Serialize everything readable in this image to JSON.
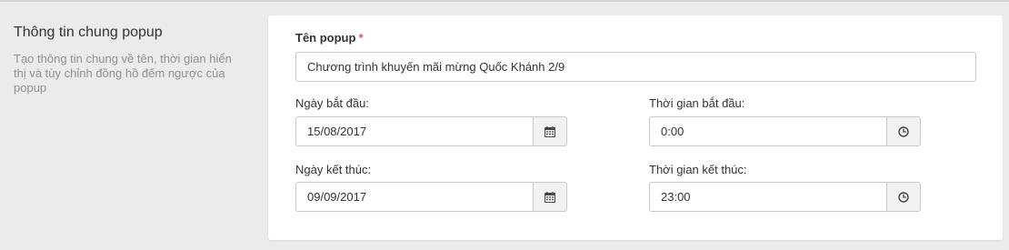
{
  "section": {
    "title": "Thông tin chung popup",
    "description": "Tạo thông tin chung về tên, thời gian hiển thị và tùy chỉnh đồng hồ đếm ngược của popup"
  },
  "form": {
    "name": {
      "label": "Tên popup",
      "required_mark": "*",
      "value": "Chương trình khuyến mãi mừng Quốc Khánh 2/9"
    },
    "start_date": {
      "label": "Ngày bắt đầu:",
      "value": "15/08/2017",
      "icon": "calendar-icon"
    },
    "start_time": {
      "label": "Thời gian bắt đầu:",
      "value": "0:00",
      "icon": "clock-icon"
    },
    "end_date": {
      "label": "Ngày kết thúc:",
      "value": "09/09/2017",
      "icon": "calendar-icon"
    },
    "end_time": {
      "label": "Thời gian kết thúc:",
      "value": "23:00",
      "icon": "clock-icon"
    }
  },
  "colors": {
    "page_background": "#ebebeb",
    "card_background": "#ffffff",
    "required_mark": "#e05a5a",
    "input_border": "#c8c8c8",
    "addon_background": "#f2f2f2",
    "description_text": "#909090"
  }
}
